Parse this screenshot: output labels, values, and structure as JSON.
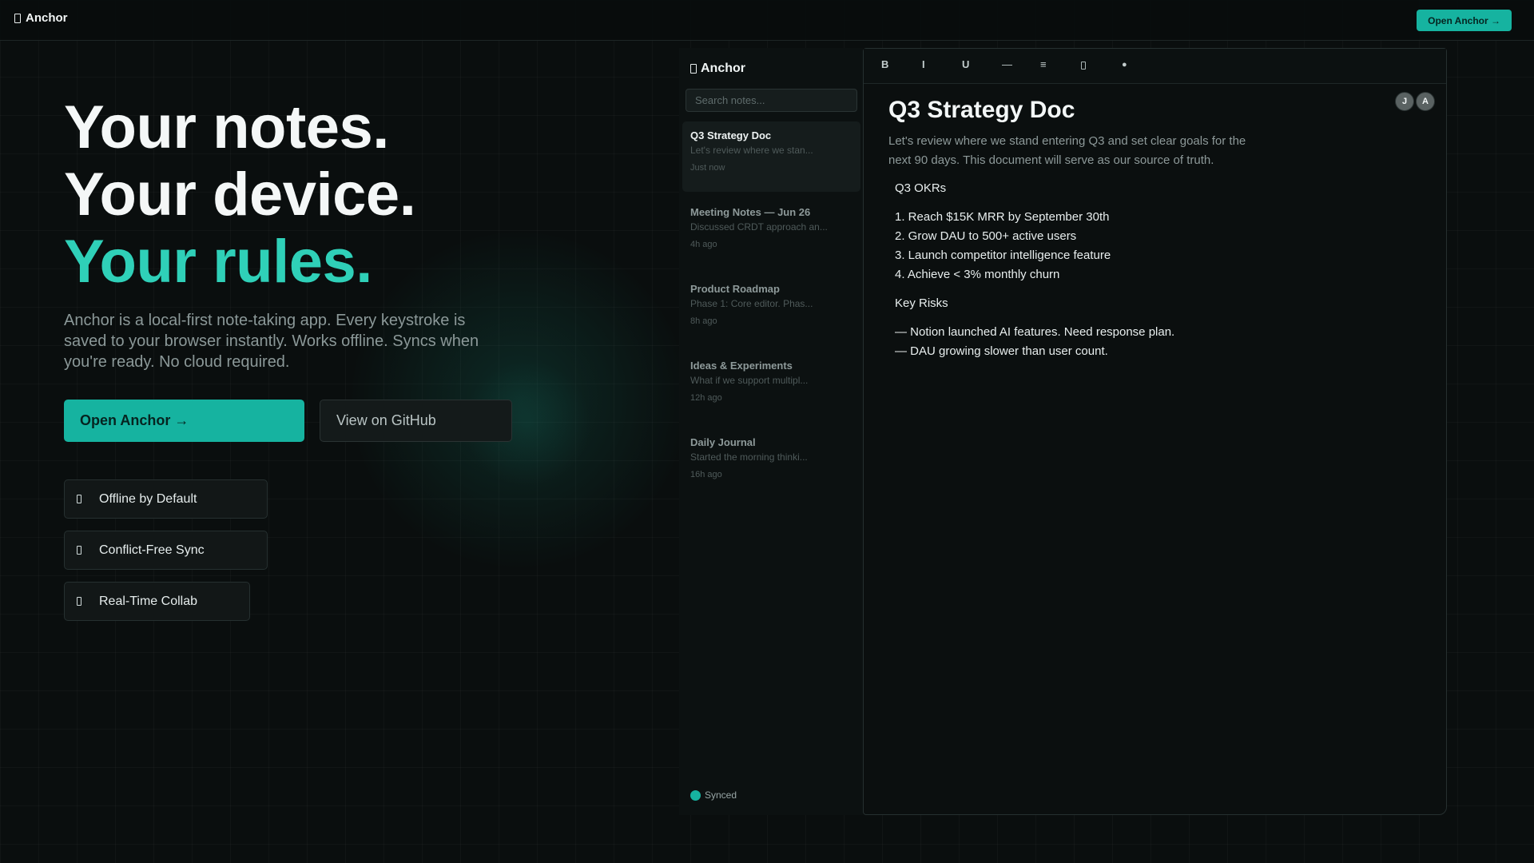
{
  "topbar": {
    "brand": "Anchor",
    "cta_label": "Open Anchor →"
  },
  "hero": {
    "title_line1": "Your notes.",
    "title_line2": "Your device.",
    "title_line3": "Your rules.",
    "description": "Anchor is a local-first note-taking app. Every keystroke is saved to your browser instantly. Works offline. Syncs when you're ready. No cloud required.",
    "primary_button": "Open Anchor →",
    "secondary_button": "View on GitHub",
    "features": [
      {
        "label": "Offline by Default"
      },
      {
        "label": "Conflict-Free Sync"
      },
      {
        "label": "Real-Time Collab"
      }
    ]
  },
  "app": {
    "sidebar": {
      "brand": "Anchor",
      "search_placeholder": "Search notes...",
      "notes": [
        {
          "title": "Q3 Strategy Doc",
          "preview": "Let's review where we stan...",
          "time": "Just now"
        },
        {
          "title": "Meeting Notes — Jun 26",
          "preview": "Discussed CRDT approach an...",
          "time": "4h ago"
        },
        {
          "title": "Product Roadmap",
          "preview": "Phase 1: Core editor. Phas...",
          "time": "8h ago"
        },
        {
          "title": "Ideas & Experiments",
          "preview": "What if we support multipl...",
          "time": "12h ago"
        },
        {
          "title": "Daily Journal",
          "preview": "Started the morning thinki...",
          "time": "16h ago"
        }
      ],
      "status": "Synced"
    },
    "toolbar": {
      "bold": "B",
      "italic": "I",
      "underline": "U",
      "divider": "—",
      "list": "≡",
      "dot": "●"
    },
    "avatars": [
      "J",
      "A"
    ],
    "document": {
      "title": "Q3 Strategy Doc",
      "lead": "Let's review where we stand entering Q3 and set clear goals for the next 90 days. This document will serve as our source of truth.",
      "okrs_heading": "Q3 OKRs",
      "okrs": [
        "1. Reach $15K MRR by September 30th",
        "2. Grow DAU to 500+ active users",
        "3. Launch competitor intelligence feature",
        "4. Achieve < 3% monthly churn"
      ],
      "risks_heading": "Key Risks",
      "risks": [
        "— Notion launched AI features. Need response plan.",
        "— DAU growing slower than user count."
      ]
    }
  },
  "colors": {
    "accent": "#16b3a0",
    "accent_text": "#2fd0b8",
    "background": "#0a0e0e"
  }
}
